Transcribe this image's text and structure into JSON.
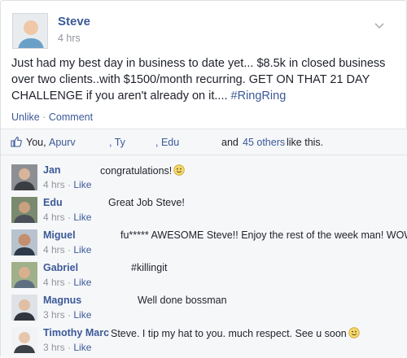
{
  "post": {
    "author": "Steve",
    "time": "4 hrs",
    "text": "Just had my best day in business to date yet... $8.5k in closed business over two clients..with $1500/month recurring. GET ON THAT 21 DAY CHALLENGE if you aren't already on it.... ",
    "hashtag": "#RingRing",
    "actions": {
      "unlike": "Unlike",
      "separator": "·",
      "comment": "Comment"
    }
  },
  "likes": {
    "you": "You,",
    "name1": "Apurv",
    "name2": ", Ty",
    "name3": ", Edu",
    "and": "and",
    "others": "45 others",
    "suffix": "like this."
  },
  "comments": [
    {
      "name": "Jan",
      "text": "congratulations!",
      "smiley": true,
      "time": "4 hrs",
      "like": "Like"
    },
    {
      "name": "Edu",
      "text": "Great Job Steve!",
      "smiley": false,
      "time": "4 hrs",
      "like": "Like"
    },
    {
      "name": "Miguel",
      "text": "fu***** AWESOME Steve!! Enjoy the rest of the week man! WOW..",
      "smiley": false,
      "time": "4 hrs",
      "like": "Like"
    },
    {
      "name": "Gabriel",
      "text": "#killingit",
      "smiley": false,
      "time": "4 hrs",
      "like": "Like"
    },
    {
      "name": "Magnus",
      "text": "Well done bossman",
      "smiley": false,
      "time": "3 hrs",
      "like": "Like"
    },
    {
      "name": "Timothy Marc",
      "text": "Steve. I tip my hat to you. much respect. See u soon",
      "smiley": true,
      "time": "3 hrs",
      "like": "Like"
    }
  ],
  "meta_separator": "·",
  "colors": {
    "link": "#3b5998",
    "muted": "#90949c",
    "text": "#1d2129",
    "section_bg": "#f6f7f9"
  }
}
